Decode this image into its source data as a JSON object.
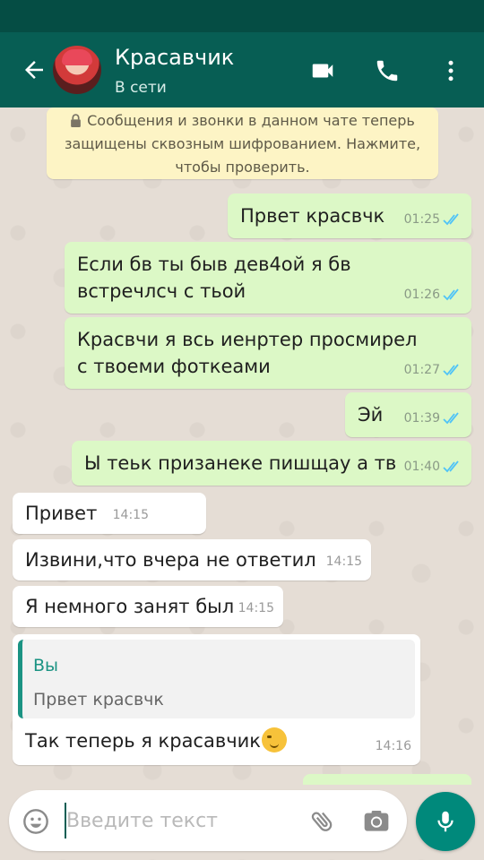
{
  "header": {
    "contact_name": "Красавчик",
    "contact_status": "В сети",
    "icons": [
      "back-arrow-icon",
      "video-call-icon",
      "phone-call-icon",
      "more-options-icon"
    ]
  },
  "encryption_notice": {
    "text": "Сообщения и звонки в данном чате теперь защищены сквозным шифрованием. Нажмите, чтобы проверить."
  },
  "messages": [
    {
      "direction": "out",
      "text": "Првет красвчк",
      "time": "01:25",
      "read": true
    },
    {
      "direction": "out",
      "text": "Если бв ты быв дев4ой я бв встречлсч с тьой",
      "time": "01:26",
      "read": true
    },
    {
      "direction": "out",
      "text": "Красвчи я всь иенртер просмирел с твоеми фоткеами",
      "time": "01:27",
      "read": true
    },
    {
      "direction": "out",
      "text": "Эй",
      "time": "01:39",
      "read": true
    },
    {
      "direction": "out",
      "text": "Ы теьк призанеке  пишщау а тв",
      "time": "01:40",
      "read": true
    },
    {
      "direction": "in",
      "text": "Привет",
      "time": "14:15"
    },
    {
      "direction": "in",
      "text": "Извини,что вчера не ответил",
      "time": "14:15"
    },
    {
      "direction": "in",
      "text": "Я немного занят был",
      "time": "14:15"
    },
    {
      "direction": "in",
      "reply_to": {
        "author": "Вы",
        "text": "Првет красвчк"
      },
      "text": "Так теперь я красавчик",
      "emoji": "smirk-emoji",
      "time": "14:16"
    }
  ],
  "composer": {
    "placeholder": "Введите текст",
    "icons": [
      "emoji-icon",
      "attach-icon",
      "camera-icon",
      "mic-icon"
    ]
  },
  "colors": {
    "header": "#075e54",
    "status_bar": "#054d44",
    "outgoing_bubble": "#dcf8c6",
    "incoming_bubble": "#ffffff",
    "read_ticks": "#4fc3f7",
    "accent": "#00897b"
  }
}
